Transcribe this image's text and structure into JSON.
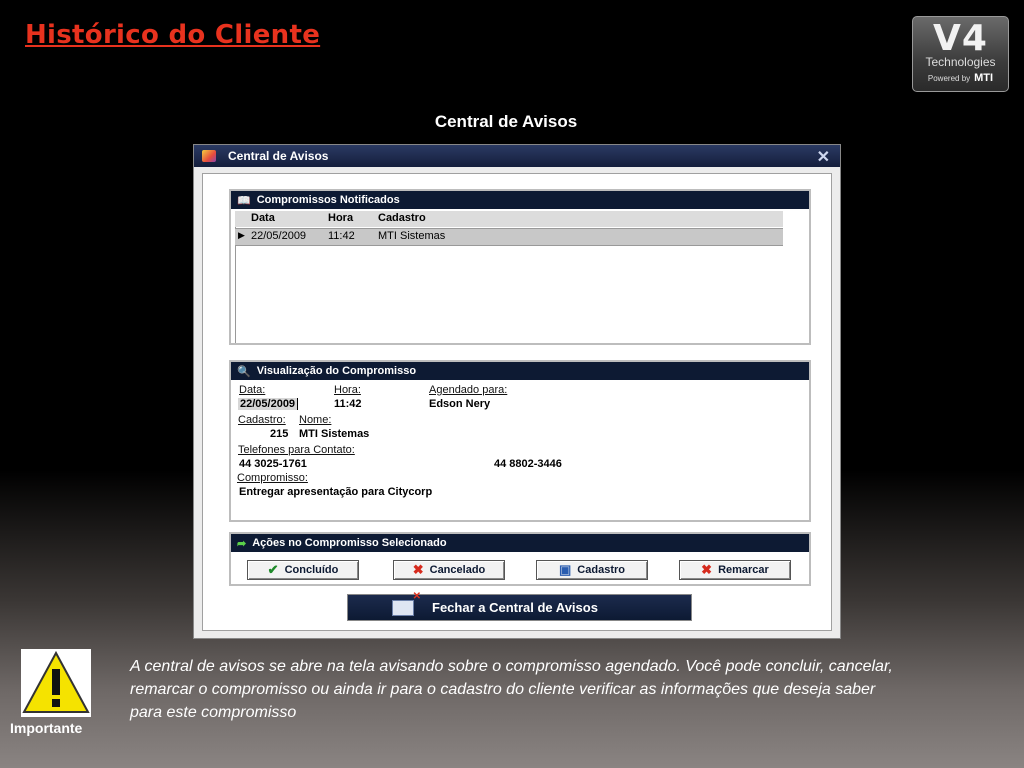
{
  "slide": {
    "title": "Histórico do Cliente",
    "subtitle": "Central de Avisos",
    "logo": {
      "main": "V4",
      "sub": "Technologies",
      "powered": "Powered by",
      "brand": "MTI"
    },
    "note": "A central de avisos se abre na tela avisando sobre o compromisso agendado. Você pode concluir, cancelar, remarcar o compromisso ou ainda ir para o cadastro do cliente verificar as informações que deseja saber para este compromisso",
    "important_label": "Importante"
  },
  "window": {
    "title": "Central de Avisos",
    "close_glyph": "✕"
  },
  "notified": {
    "header": "Compromissos Notificados",
    "columns": [
      "Data",
      "Hora",
      "Cadastro"
    ],
    "rows": [
      {
        "data": "22/05/2009",
        "hora": "11:42",
        "cadastro": "MTI Sistemas"
      }
    ]
  },
  "view": {
    "header": "Visualização do Compromisso",
    "data_label": "Data:",
    "data_value": "22/05/2009",
    "hora_label": "Hora:",
    "hora_value": "11:42",
    "agendado_label": "Agendado para:",
    "agendado_value": "Edson Nery",
    "cadastro_label": "Cadastro:",
    "nome_label": "Nome:",
    "cadastro_value": "215",
    "nome_value": "MTI Sistemas",
    "telefones_label": "Telefones para Contato:",
    "telefone1": "44  3025-1761",
    "telefone2": "44  8802-3446",
    "compromisso_label": "Compromisso:",
    "compromisso_value": "Entregar apresentação para Citycorp"
  },
  "actions": {
    "header": "Ações no Compromisso Selecionado",
    "concluido": "Concluído",
    "cancelado": "Cancelado",
    "cadastro": "Cadastro",
    "remarcar": "Remarcar"
  },
  "footer": {
    "close_label": "Fechar a Central de Avisos"
  },
  "colors": {
    "title_red": "#e8321e",
    "header_navy": "#0d1a33"
  }
}
